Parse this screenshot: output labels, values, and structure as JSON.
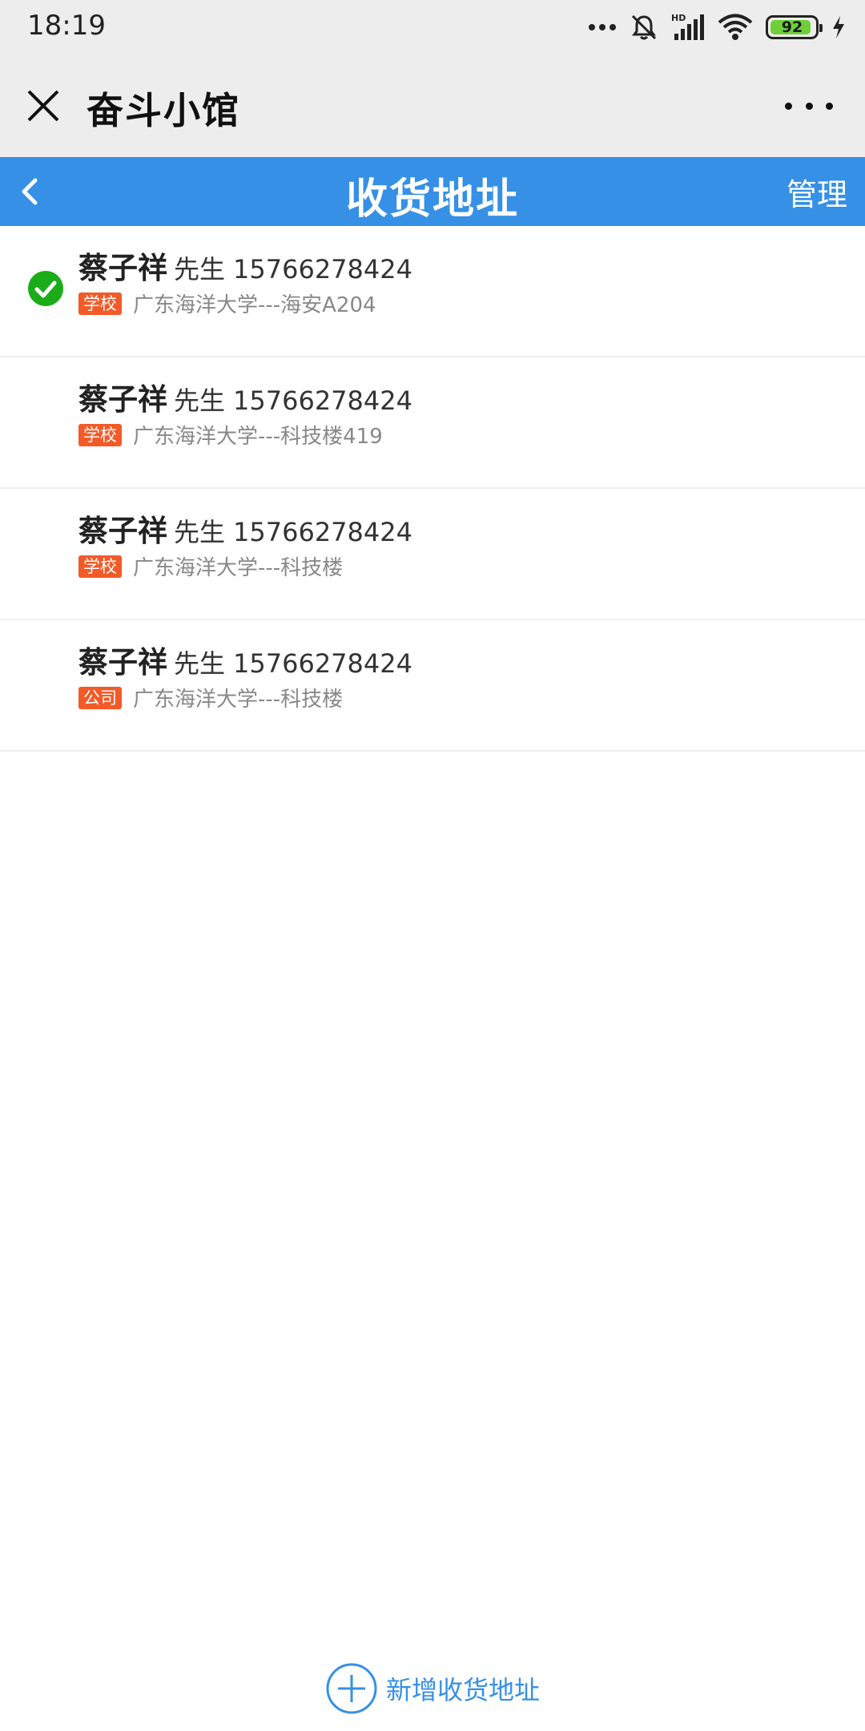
{
  "status_bar": {
    "time": "18:19",
    "network_label": "HD",
    "battery_level": "92",
    "battery_fraction": 0.92,
    "icons": [
      "more-dots-icon",
      "mute-bell-icon",
      "signal-icon",
      "wifi-icon",
      "battery-icon",
      "charging-bolt-icon"
    ]
  },
  "mini_program": {
    "title": "奋斗小馆",
    "close_icon": "close-icon",
    "more_icon": "more-dots-icon"
  },
  "nav": {
    "title": "收货地址",
    "manage_label": "管理",
    "back_icon": "chevron-left-icon",
    "color": "#3590e6"
  },
  "addresses": [
    {
      "name": "蔡子祥",
      "title": "先生",
      "phone": "15766278424",
      "tag": "学校",
      "address": "广东海洋大学---海安A204",
      "selected": true
    },
    {
      "name": "蔡子祥",
      "title": "先生",
      "phone": "15766278424",
      "tag": "学校",
      "address": "广东海洋大学---科技楼419",
      "selected": false
    },
    {
      "name": "蔡子祥",
      "title": "先生",
      "phone": "15766278424",
      "tag": "学校",
      "address": "广东海洋大学---科技楼",
      "selected": false
    },
    {
      "name": "蔡子祥",
      "title": "先生",
      "phone": "15766278424",
      "tag": "公司",
      "address": "广东海洋大学---科技楼",
      "selected": false
    }
  ],
  "add_button": {
    "label": "新增收货地址",
    "icon": "plus-circle-icon"
  },
  "colors": {
    "accent": "#3590e6",
    "tag": "#f25a28",
    "check": "#1aad19"
  }
}
